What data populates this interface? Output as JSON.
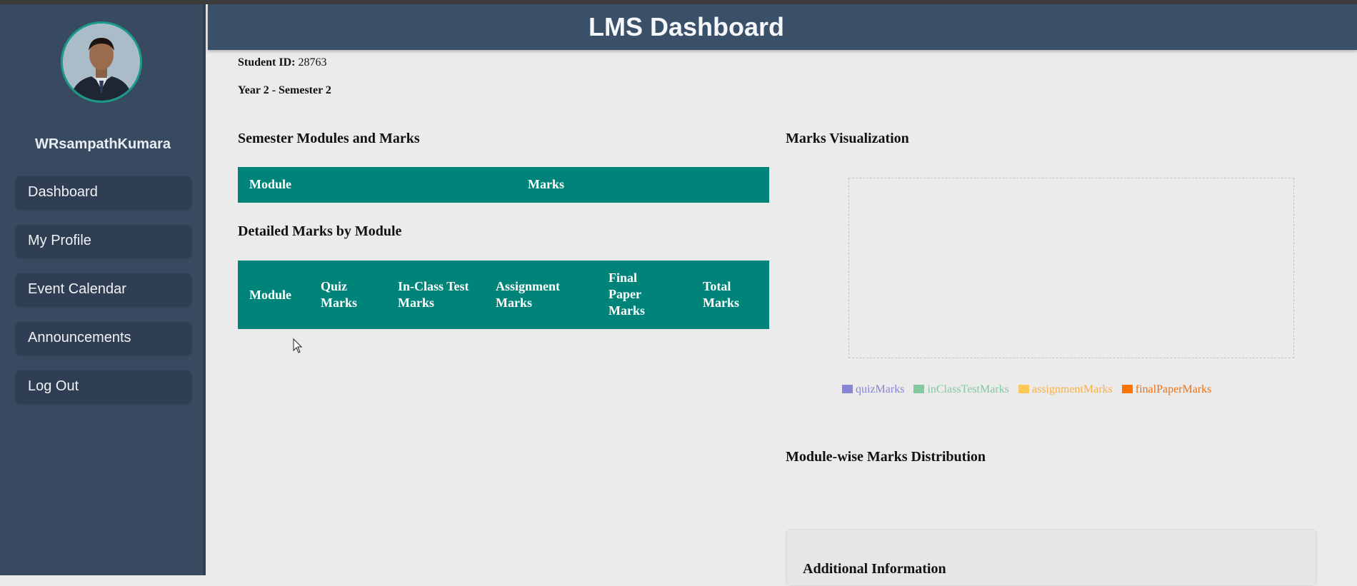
{
  "header": {
    "title": "LMS Dashboard"
  },
  "sidebar": {
    "username": "WRsampathKumara",
    "avatar_icon": "person-avatar",
    "items": [
      {
        "label": "Dashboard"
      },
      {
        "label": "My Profile"
      },
      {
        "label": "Event Calendar"
      },
      {
        "label": "Announcements"
      },
      {
        "label": "Log Out"
      }
    ]
  },
  "student": {
    "id_label": "Student ID:",
    "id_value": "28763",
    "year_semester": "Year 2 - Semester 2"
  },
  "semester_modules": {
    "heading": "Semester Modules and Marks",
    "columns": [
      "Module",
      "Marks"
    ],
    "rows": []
  },
  "detailed_marks": {
    "heading": "Detailed Marks by Module",
    "columns": [
      "Module",
      "Quiz Marks",
      "In-Class Test Marks",
      "Assignment Marks",
      "Final Paper Marks",
      "Total Marks"
    ],
    "rows": []
  },
  "visualization": {
    "heading": "Marks Visualization",
    "legend": [
      {
        "label": "quizMarks",
        "color": "#8884d8"
      },
      {
        "label": "inClassTestMarks",
        "color": "#82ca9d"
      },
      {
        "label": "assignmentMarks",
        "color": "#ffc658"
      },
      {
        "label": "finalPaperMarks",
        "color": "#ff7300"
      }
    ]
  },
  "distribution": {
    "heading": "Module-wise Marks Distribution"
  },
  "additional_info": {
    "heading": "Additional Information"
  },
  "colors": {
    "sidebar_bg": "#384a60",
    "header_bg": "#3a5068",
    "table_header_bg": "#00847a",
    "avatar_border": "#1a9a8a"
  }
}
